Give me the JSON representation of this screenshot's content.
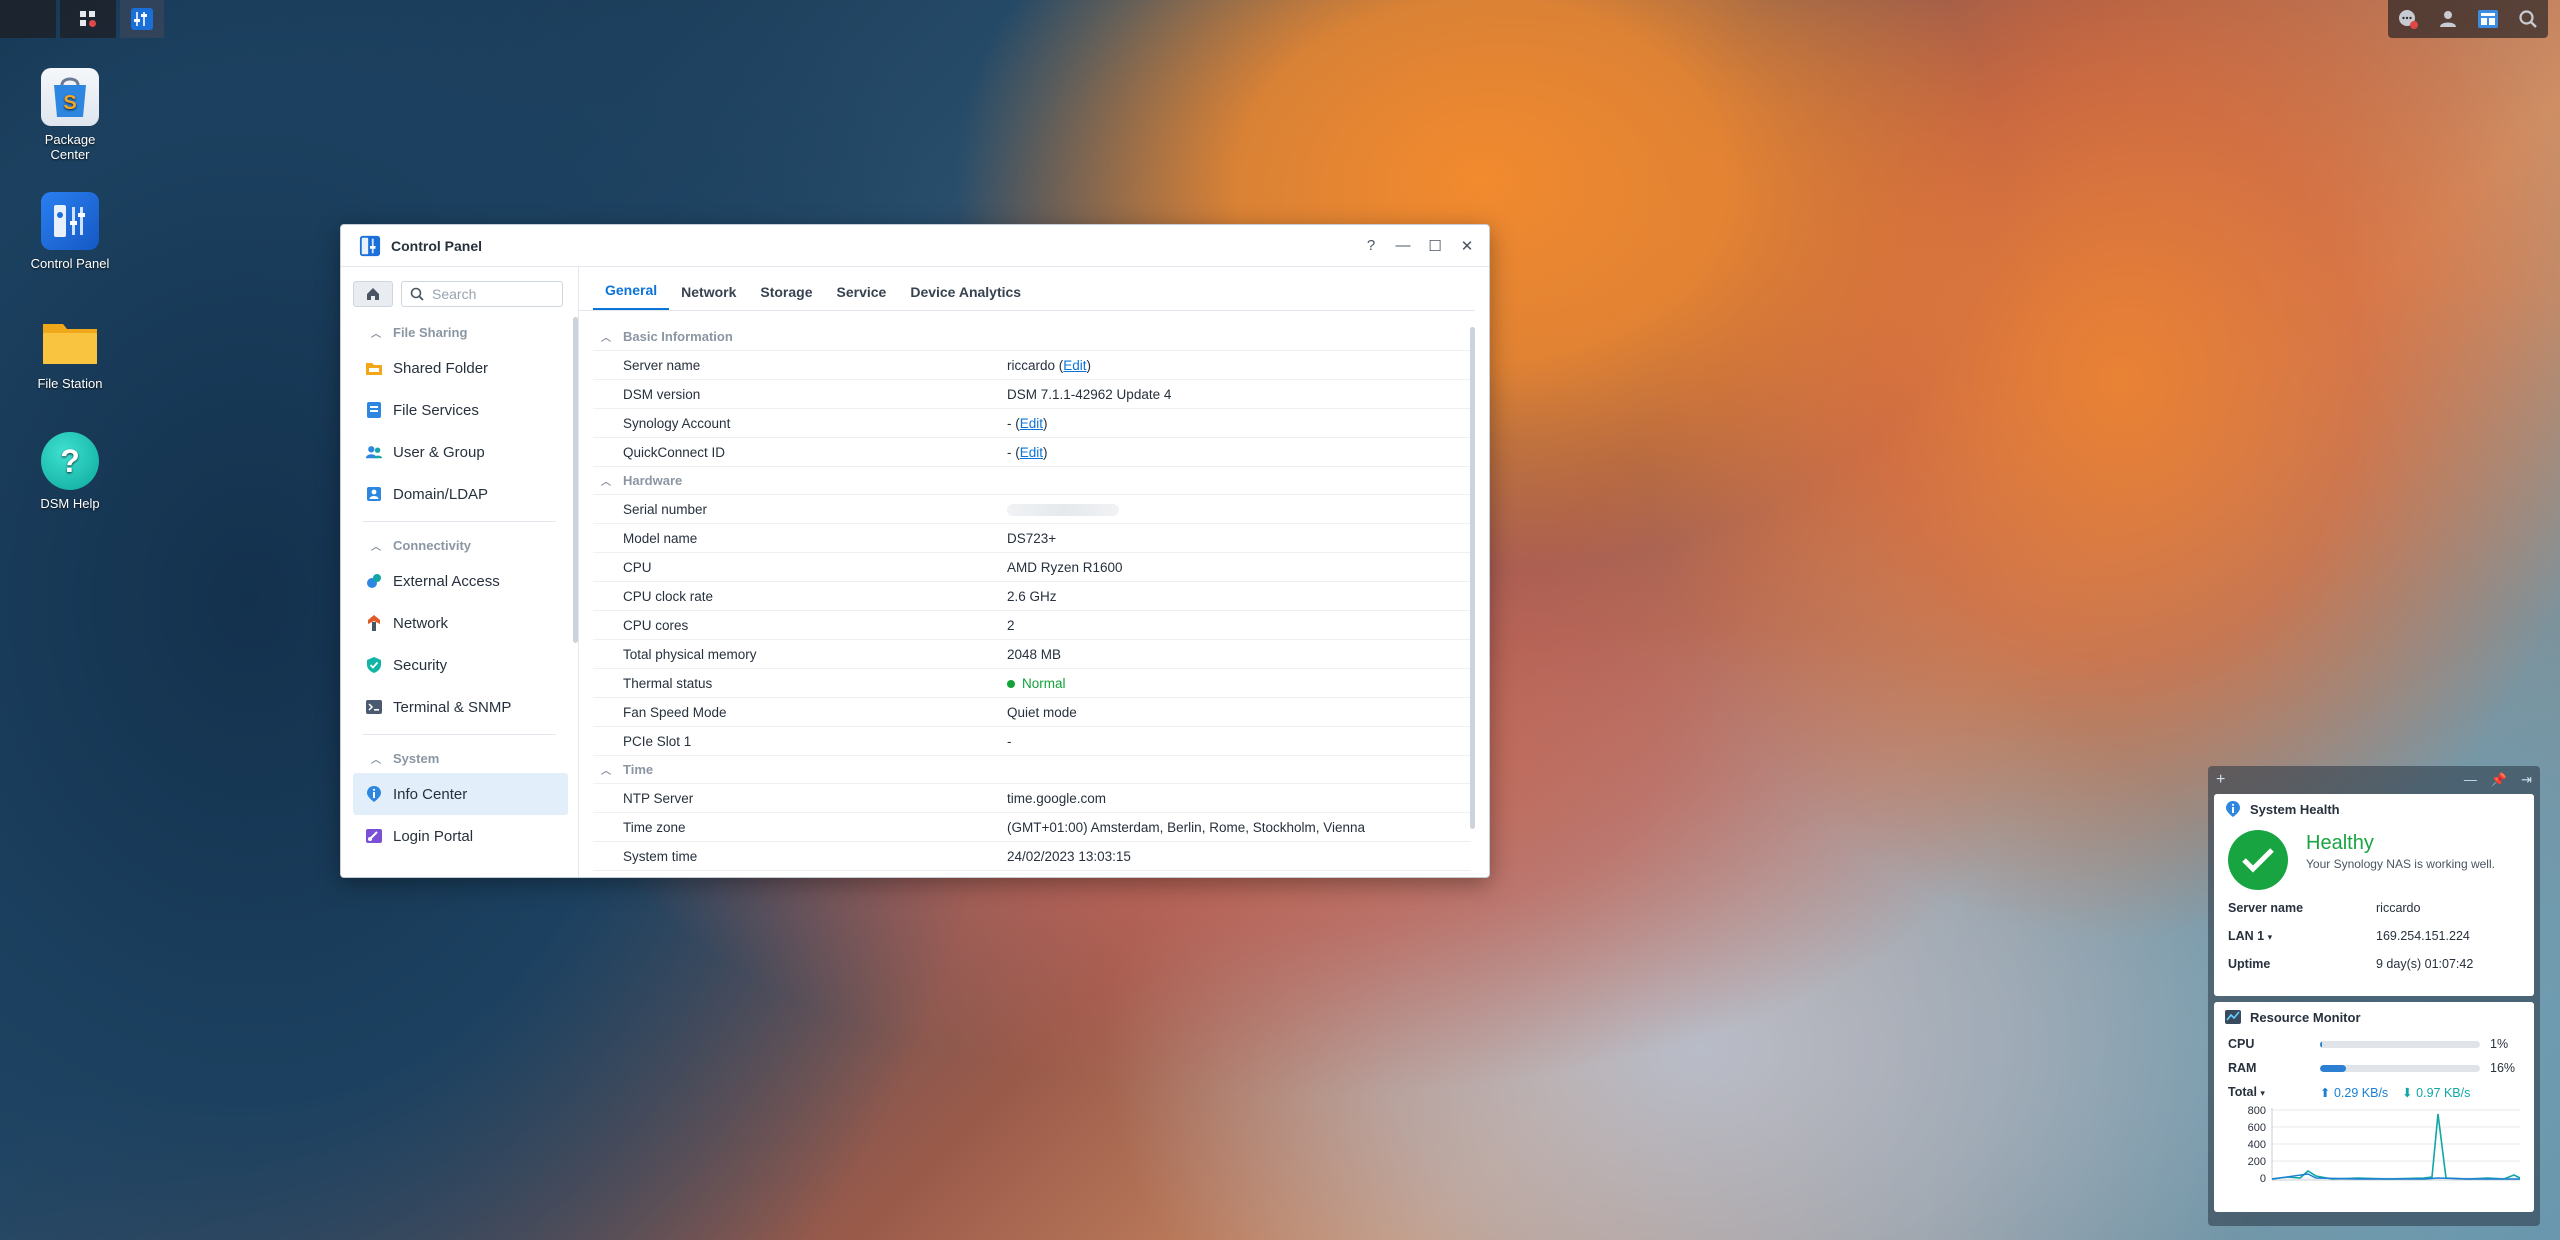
{
  "desktop": {
    "icons": [
      {
        "label_line1": "Package",
        "label_line2": "Center"
      },
      {
        "label_line1": "Control Panel",
        "label_line2": ""
      },
      {
        "label_line1": "File Station",
        "label_line2": ""
      },
      {
        "label_line1": "DSM Help",
        "label_line2": ""
      }
    ]
  },
  "window": {
    "title": "Control Panel",
    "help": "?",
    "minimize": "—",
    "maximize": "☐",
    "close": "✕"
  },
  "sidebar": {
    "search_placeholder": "Search",
    "groups": [
      {
        "title": "File Sharing",
        "items": [
          "Shared Folder",
          "File Services",
          "User & Group",
          "Domain/LDAP"
        ]
      },
      {
        "title": "Connectivity",
        "items": [
          "External Access",
          "Network",
          "Security",
          "Terminal & SNMP"
        ]
      },
      {
        "title": "System",
        "items": [
          "Info Center",
          "Login Portal"
        ]
      }
    ]
  },
  "tabs": [
    "General",
    "Network",
    "Storage",
    "Service",
    "Device Analytics"
  ],
  "info": {
    "basic": {
      "title": "Basic Information",
      "rows": [
        {
          "label": "Server name",
          "value": "riccardo",
          "edit": "Edit"
        },
        {
          "label": "DSM version",
          "value": "DSM 7.1.1-42962 Update 4"
        },
        {
          "label": "Synology Account",
          "value": "-",
          "edit": "Edit"
        },
        {
          "label": "QuickConnect ID",
          "value": "-",
          "edit": "Edit"
        }
      ]
    },
    "hardware": {
      "title": "Hardware",
      "rows": [
        {
          "label": "Serial number",
          "value": ""
        },
        {
          "label": "Model name",
          "value": "DS723+"
        },
        {
          "label": "CPU",
          "value": "AMD Ryzen R1600"
        },
        {
          "label": "CPU clock rate",
          "value": "2.6 GHz"
        },
        {
          "label": "CPU cores",
          "value": "2"
        },
        {
          "label": "Total physical memory",
          "value": "2048 MB"
        },
        {
          "label": "Thermal status",
          "value": "Normal"
        },
        {
          "label": "Fan Speed Mode",
          "value": "Quiet mode"
        },
        {
          "label": "PCIe Slot 1",
          "value": "-"
        }
      ]
    },
    "time": {
      "title": "Time",
      "rows": [
        {
          "label": "NTP Server",
          "value": "time.google.com"
        },
        {
          "label": "Time zone",
          "value": "(GMT+01:00) Amsterdam, Berlin, Rome, Stockholm, Vienna"
        },
        {
          "label": "System time",
          "value": "24/02/2023 13:03:15"
        }
      ]
    }
  },
  "widgets": {
    "health": {
      "title": "System Health",
      "status": "Healthy",
      "message": "Your Synology NAS is working well.",
      "server_label": "Server name",
      "server_value": "riccardo",
      "lan_label": "LAN 1",
      "lan_value": "169.254.151.224",
      "uptime_label": "Uptime",
      "uptime_value": "9 day(s) 01:07:42"
    },
    "resource": {
      "title": "Resource Monitor",
      "cpu_label": "CPU",
      "cpu_value": "1%",
      "cpu_fraction": 0.01,
      "ram_label": "RAM",
      "ram_value": "16%",
      "ram_fraction": 0.16,
      "total_label": "Total",
      "upload": "0.29 KB/s",
      "download": "0.97 KB/s",
      "chart_ticks": [
        "800",
        "600",
        "400",
        "200",
        "0"
      ],
      "colors": {
        "upload": "#1a7fd4",
        "download": "#12a6a6"
      }
    }
  }
}
